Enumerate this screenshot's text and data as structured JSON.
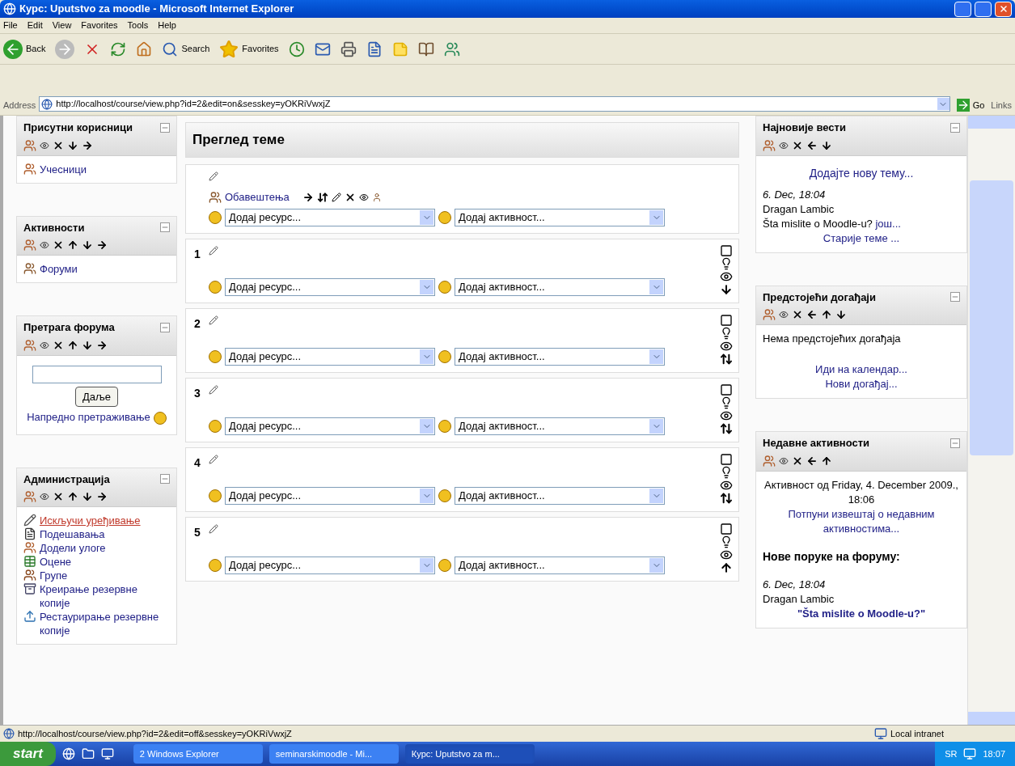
{
  "window": {
    "title": "Курс: Uputstvo za moodle - Microsoft Internet Explorer"
  },
  "menu": [
    "File",
    "Edit",
    "View",
    "Favorites",
    "Tools",
    "Help"
  ],
  "toolbar": [
    {
      "kind": "back",
      "label": "Back"
    },
    {
      "kind": "forward"
    },
    {
      "kind": "stop"
    },
    {
      "kind": "refresh"
    },
    {
      "kind": "home"
    },
    {
      "kind": "search",
      "label": "Search"
    },
    {
      "kind": "favorites",
      "label": "Favorites"
    },
    {
      "kind": "history"
    },
    {
      "kind": "mail"
    },
    {
      "kind": "print"
    },
    {
      "kind": "word"
    },
    {
      "kind": "note"
    },
    {
      "kind": "research"
    },
    {
      "kind": "messenger"
    }
  ],
  "address": {
    "label": "Address",
    "url": "http://localhost/course/view.php?id=2&edit=on&sesskey=yOKRiVwxjZ",
    "go": "Go",
    "links": "Links"
  },
  "left_blocks": [
    {
      "title": "Присутни корисници",
      "controls": [
        {
          "kind": "roles"
        },
        {
          "kind": "hide"
        },
        {
          "kind": "delete"
        },
        {
          "kind": "down"
        },
        {
          "kind": "right"
        }
      ],
      "items": [
        {
          "kind": "users",
          "text": "Учесници"
        }
      ]
    },
    {
      "title": "Активности",
      "controls": [
        {
          "kind": "roles"
        },
        {
          "kind": "hide"
        },
        {
          "kind": "delete"
        },
        {
          "kind": "up"
        },
        {
          "kind": "down"
        },
        {
          "kind": "right"
        }
      ],
      "items": [
        {
          "kind": "forum",
          "text": "Форуми"
        }
      ]
    },
    {
      "title": "Претрага форума",
      "controls": [
        {
          "kind": "roles"
        },
        {
          "kind": "hide"
        },
        {
          "kind": "delete"
        },
        {
          "kind": "up"
        },
        {
          "kind": "down"
        },
        {
          "kind": "right"
        }
      ],
      "search": {
        "button": "Даље",
        "advanced": "Напредно претраживање"
      }
    },
    {
      "title": "Администрација",
      "controls": [
        {
          "kind": "roles"
        },
        {
          "kind": "hide"
        },
        {
          "kind": "delete"
        },
        {
          "kind": "up"
        },
        {
          "kind": "down"
        },
        {
          "kind": "right"
        }
      ],
      "items": [
        {
          "kind": "edit",
          "text": "Искључи уређивање",
          "alert": true
        },
        {
          "kind": "settings",
          "text": "Подешавања",
          "alert": false
        },
        {
          "kind": "roles",
          "text": "Додели улоге",
          "alert": false
        },
        {
          "kind": "grades",
          "text": "Оцене",
          "alert": false
        },
        {
          "kind": "groups",
          "text": "Групе",
          "alert": false
        },
        {
          "kind": "backup",
          "text": "Креирање резервне копије",
          "alert": false
        },
        {
          "kind": "restore",
          "text": "Рестаурирање резервне копије",
          "alert": false
        }
      ]
    }
  ],
  "main": {
    "title": "Преглед теме",
    "sections": [
      {
        "forum": {
          "text": "Обавештења"
        },
        "kind": "general",
        "resource_placeholder": "Додај ресурс...",
        "activity_placeholder": "Додај активност..."
      },
      {
        "number": "1",
        "kind": "down",
        "resource_placeholder": "Додај ресурс...",
        "activity_placeholder": "Додај активност..."
      },
      {
        "number": "2",
        "kind": "both",
        "resource_placeholder": "Додај ресурс...",
        "activity_placeholder": "Додај активност..."
      },
      {
        "number": "3",
        "kind": "both",
        "resource_placeholder": "Додај ресурс...",
        "activity_placeholder": "Додај активност..."
      },
      {
        "number": "4",
        "kind": "both",
        "resource_placeholder": "Додај ресурс...",
        "activity_placeholder": "Додај активност..."
      },
      {
        "number": "5",
        "kind": "up",
        "resource_placeholder": "Додај ресурс...",
        "activity_placeholder": "Додај активност..."
      }
    ]
  },
  "right_blocks": [
    {
      "title": "Најновије вести",
      "controls": [
        {
          "kind": "roles"
        },
        {
          "kind": "hide"
        },
        {
          "kind": "delete"
        },
        {
          "kind": "left"
        },
        {
          "kind": "down"
        }
      ],
      "kind": "news",
      "add": "Додајте нову тему...",
      "date": "6. Dec, 18:04",
      "author": "Dragan Lambic",
      "subject": "Šta mislite o Moodle-u?",
      "more": "још...",
      "older": "Старије теме ..."
    },
    {
      "title": "Предстојећи догађаји",
      "controls": [
        {
          "kind": "roles"
        },
        {
          "kind": "hide"
        },
        {
          "kind": "delete"
        },
        {
          "kind": "left"
        },
        {
          "kind": "up"
        },
        {
          "kind": "down"
        }
      ],
      "kind": "events",
      "empty": "Нема предстојећих догађаја",
      "links": [
        "Иди на календар...",
        "Нови догађај..."
      ]
    },
    {
      "title": "Недавне активности",
      "controls": [
        {
          "kind": "roles"
        },
        {
          "kind": "hide"
        },
        {
          "kind": "delete"
        },
        {
          "kind": "left"
        },
        {
          "kind": "up"
        }
      ],
      "kind": "recent",
      "since": "Активност од Friday, 4. December 2009., 18:06",
      "report": "Потпуни извештај о недавним активностима...",
      "heading": "Нове поруке на форуму:",
      "date": "6. Dec, 18:04",
      "author": "Dragan Lambic",
      "subject": "\"Šta mislite o Moodle-u?\""
    }
  ],
  "status_bar": {
    "url": "http://localhost/course/view.php?id=2&edit=off&sesskey=yOKRiVwxjZ",
    "zone": "Local intranet"
  },
  "taskbar": {
    "start": "start",
    "tasks": [
      {
        "text": "2 Windows Explorer",
        "selected": false
      },
      {
        "text": "seminarskimoodle - Mi...",
        "selected": false
      },
      {
        "text": "Курс: Uputstvo za m...",
        "selected": true
      }
    ],
    "lang": "SR",
    "clock": "18:07"
  }
}
